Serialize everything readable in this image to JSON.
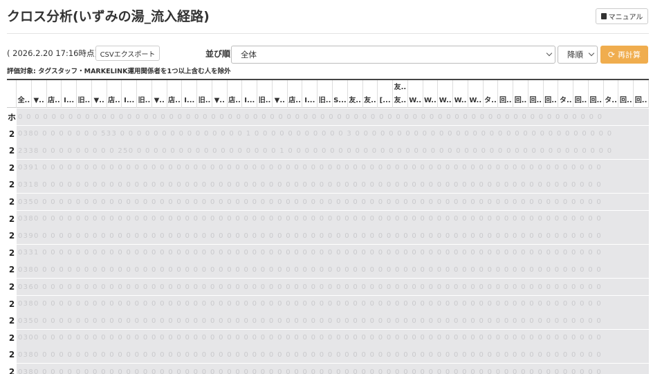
{
  "title": "クロス分析(いずみの湯_流入経路)",
  "manual_label": "マニュアル",
  "timestamp": "( 2026.2.20 17:16時点)",
  "csv_label": "CSVエクスポート",
  "sort": {
    "label": "並び順",
    "value": "全体"
  },
  "order": {
    "value": "降順"
  },
  "recalc_label": "再計算",
  "note": {
    "label": "評価対象:",
    "text": " タグスタッフ・MARKELINK運用関係者を1つ以上含む人を除外"
  },
  "columns": [
    "全..",
    "▼..",
    "店..",
    "I...",
    "旧..",
    "▼..",
    "店..",
    "I...",
    "旧..",
    "▼..",
    "店..",
    "I...",
    "旧..",
    "▼..",
    "店..",
    "I...",
    "旧..",
    "▼..",
    "店..",
    "I...",
    "旧..",
    "S...",
    "友..",
    "友..",
    "[...",
    [
      "友..",
      "友.."
    ],
    "W..",
    "W..",
    "W..",
    "W..",
    "W..",
    "タ..",
    "回..",
    "回..",
    "回..",
    "回..",
    "タ..",
    "回..",
    "回..",
    "タ..",
    "回..",
    "回.."
  ],
  "rows": [
    {
      "label": "ホ",
      "data": "0 0 0 0 0 0 0 0 0 0 0 0 0 0 0 0 0 0 0 0 0 0 0 0 0 0 0 0 0 0 0 0 0 0 0 0 0 0 0 0 0 0 0 0 0 0 0 0 0 0 0 0 0 0 0 0 0 0 0 0 0 0 0 0 0 0 0 0 0 0"
    },
    {
      "label": "2",
      "data": "0380 0 0 0 0 0 0 0 533 0 0 0 0 0 0 0 0 0 0 0 0 0 0 0 1 0 0 0 0 0 0 0 0 0 0 0 3 0 0 0 0 0 0 0 0 0 0 0 0 0 0 0 0 0 0 0 0 0 0 0 0 0 0 0 0 0 0 0"
    },
    {
      "label": "2",
      "data": "2338 0 0 0 0 0 0 0 0 0 250 0 0 0 0 0 0 0 0 0 0 0 0 0 0 0 0 0 1 0 0 0 0 0 0 0 0 0 0 0 0 0 0 0 0 0 0 0 0 0 0 0 0 0 0 0 0 0 0 0 0 0 0 0 0 0 0 0"
    },
    {
      "label": "2",
      "data": "0391 0 0 0 0 0 0 0 0 0 0 0 0 0 0 0 0 0 0 0 0 0 0 0 0 0 0 0 0 0 0 0 0 0 0 0 0 0 0 0 0 0 0 0 0 0 0 0 0 0 0 0 0 0 0 0 0 0 0 0 0 0 0 0 0 0 0 0"
    },
    {
      "label": "2",
      "data": "0318 0 0 0 0 0 0 0 0 0 0 0 0 0 0 0 0 0 0 0 0 0 0 0 0 0 0 0 0 0 0 0 0 0 0 0 0 0 0 0 0 0 0 0 0 0 0 0 0 0 0 0 0 0 0 0 0 0 0 0 0 0 0 0 0 0 0 0"
    },
    {
      "label": "2",
      "data": "0350 0 0 0 0 0 0 0 0 0 0 0 0 0 0 0 0 0 0 0 0 0 0 0 0 0 0 0 0 0 0 0 0 0 0 0 0 0 0 0 0 0 0 0 0 0 0 0 0 0 0 0 0 0 0 0 0 0 0 0 0 0 0 0 0 0 0 0"
    },
    {
      "label": "2",
      "data": "0380 0 0 0 0 0 0 0 0 0 0 0 0 0 0 0 0 0 0 0 0 0 0 0 0 0 0 0 0 0 0 0 0 0 0 0 0 0 0 0 0 0 0 0 0 0 0 0 0 0 0 0 0 0 0 0 0 0 0 0 0 0 0 0 0 0 0 0"
    },
    {
      "label": "2",
      "data": "0390 0 0 0 0 0 0 0 0 0 0 0 0 0 0 0 0 0 0 0 0 0 0 0 0 0 0 0 0 0 0 0 0 0 0 0 0 0 0 0 0 0 0 0 0 0 0 0 0 0 0 0 0 0 0 0 0 0 0 0 0 0 0 0 0 0 0 0"
    },
    {
      "label": "2",
      "data": "0331 0 0 0 0 0 0 0 0 0 0 0 0 0 0 0 0 0 0 0 0 0 0 0 0 0 0 0 0 0 0 0 0 0 0 0 0 0 0 0 0 0 0 0 0 0 0 0 0 0 0 0 0 0 0 0 0 0 0 0 0 0 0 0 0 0 0 0"
    },
    {
      "label": "2",
      "data": "0380 0 0 0 0 0 0 0 0 0 0 0 0 0 0 0 0 0 0 0 0 0 0 0 0 0 0 0 0 0 0 0 0 0 0 0 0 0 0 0 0 0 0 0 0 0 0 0 0 0 0 0 0 0 0 0 0 0 0 0 0 0 0 0 0 0 0 0"
    },
    {
      "label": "2",
      "data": "0360 0 0 0 0 0 0 0 0 0 0 0 0 0 0 0 0 0 0 0 0 0 0 0 0 0 0 0 0 0 0 0 0 0 0 0 0 0 0 0 0 0 0 0 0 0 0 0 0 0 0 0 0 0 0 0 0 0 0 0 0 0 0 0 0 0 0 0"
    },
    {
      "label": "2",
      "data": "0380 0 0 0 0 0 0 0 0 0 0 0 0 0 0 0 0 0 0 0 0 0 0 0 0 0 0 0 0 0 0 0 0 0 0 0 0 0 0 0 0 0 0 0 0 0 0 0 0 0 0 0 0 0 0 0 0 0 0 0 0 0 0 0 0 0 0 0"
    },
    {
      "label": "2",
      "data": "0350 0 0 0 0 0 0 0 0 0 0 0 0 0 0 0 0 0 0 0 0 0 0 0 0 0 0 0 0 0 0 0 0 0 0 0 0 0 0 0 0 0 0 0 0 0 0 0 0 0 0 0 0 0 0 0 0 0 0 0 0 0 0 0 0 0 0 0"
    },
    {
      "label": "2",
      "data": "0300 0 0 0 0 0 0 0 0 0 0 0 0 0 0 0 0 0 0 0 0 0 0 0 0 0 0 0 0 0 0 0 0 0 0 0 0 0 0 0 0 0 0 0 0 0 0 0 0 0 0 0 0 0 0 0 0 0 0 0 0 0 0 0 0 0 0 0"
    },
    {
      "label": "2",
      "data": "0380 0 0 0 0 0 0 0 0 0 0 0 0 0 0 0 0 0 0 0 0 0 0 0 0 0 0 0 0 0 0 0 0 0 0 0 0 0 0 0 0 0 0 0 0 0 0 0 0 0 0 0 0 0 0 0 0 0 0 0 0 0 0 0 0 0 0 0"
    },
    {
      "label": "2",
      "data": "0380 0 0 0 0 0 0 0 0 0 0 0 0 0 0 0 0 0 0 0 0 0 0 0 0 0 0 0 0 0 0 0 0 0 0 0 0 0 0 0 0 0 0 0 0 0 0 0 0 0 0 0 0 0 0 0 0 0 0 0 0 0 0 0 0 0 0 0"
    }
  ]
}
